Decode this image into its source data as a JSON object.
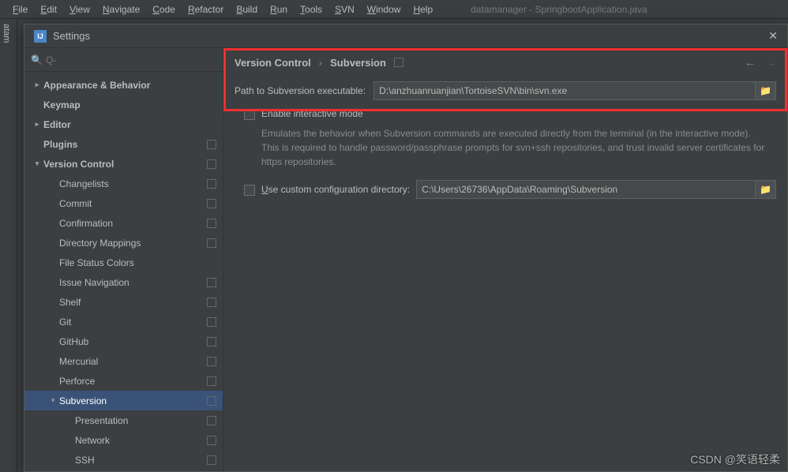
{
  "menubar": {
    "items": [
      "File",
      "Edit",
      "View",
      "Navigate",
      "Code",
      "Refactor",
      "Build",
      "Run",
      "Tools",
      "SVN",
      "Window",
      "Help"
    ],
    "window_title": "datamanager - SpringbootApplication.java"
  },
  "leftbar": {
    "tab": "atam"
  },
  "dialog": {
    "title": "Settings",
    "search_placeholder": "Q-"
  },
  "sidebar": {
    "items": [
      {
        "label": "Appearance & Behavior",
        "depth": 0,
        "chevron": ">",
        "bold": true
      },
      {
        "label": "Keymap",
        "depth": 0,
        "chevron": "",
        "bold": true
      },
      {
        "label": "Editor",
        "depth": 0,
        "chevron": ">",
        "bold": true
      },
      {
        "label": "Plugins",
        "depth": 0,
        "chevron": "",
        "bold": true,
        "badge": true
      },
      {
        "label": "Version Control",
        "depth": 0,
        "chevron": "v",
        "bold": true,
        "badge": true
      },
      {
        "label": "Changelists",
        "depth": 1,
        "chevron": "",
        "badge": true
      },
      {
        "label": "Commit",
        "depth": 1,
        "chevron": "",
        "badge": true
      },
      {
        "label": "Confirmation",
        "depth": 1,
        "chevron": "",
        "badge": true
      },
      {
        "label": "Directory Mappings",
        "depth": 1,
        "chevron": "",
        "badge": true
      },
      {
        "label": "File Status Colors",
        "depth": 1,
        "chevron": ""
      },
      {
        "label": "Issue Navigation",
        "depth": 1,
        "chevron": "",
        "badge": true
      },
      {
        "label": "Shelf",
        "depth": 1,
        "chevron": "",
        "badge": true
      },
      {
        "label": "Git",
        "depth": 1,
        "chevron": "",
        "badge": true
      },
      {
        "label": "GitHub",
        "depth": 1,
        "chevron": "",
        "badge": true
      },
      {
        "label": "Mercurial",
        "depth": 1,
        "chevron": "",
        "badge": true
      },
      {
        "label": "Perforce",
        "depth": 1,
        "chevron": "",
        "badge": true
      },
      {
        "label": "Subversion",
        "depth": 1,
        "chevron": "v",
        "badge": true,
        "selected": true
      },
      {
        "label": "Presentation",
        "depth": 2,
        "chevron": "",
        "badge": true
      },
      {
        "label": "Network",
        "depth": 2,
        "chevron": "",
        "badge": true
      },
      {
        "label": "SSH",
        "depth": 2,
        "chevron": "",
        "badge": true
      }
    ]
  },
  "breadcrumb": {
    "part1": "Version Control",
    "part2": "Subversion"
  },
  "form": {
    "path_label": "Path to Subversion executable:",
    "path_value": "D:\\anzhuanruanjian\\TortoiseSVN\\bin\\svn.exe",
    "interactive_label": "Enable interactive mode",
    "interactive_help1": "Emulates the behavior when Subversion commands are executed directly from the terminal (in the interactive mode).",
    "interactive_help2": "This is required to handle password/passphrase prompts for svn+ssh repositories, and trust invalid server certificates for https repositories.",
    "config_label": "Use custom configuration directory:",
    "config_value": "C:\\Users\\26736\\AppData\\Roaming\\Subversion"
  },
  "watermark": "CSDN @笑语轻柔"
}
